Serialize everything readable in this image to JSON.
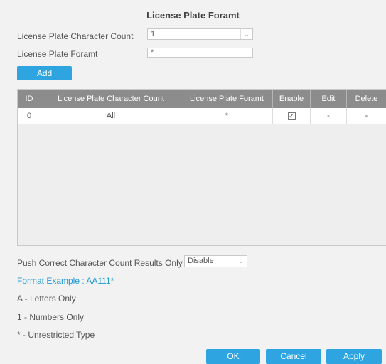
{
  "dialog": {
    "title": "License Plate Foramt"
  },
  "form": {
    "count_label": "License Plate Character Count",
    "count_value": "1",
    "format_label": "License Plate Foramt",
    "format_value": "*",
    "add_button": "Add"
  },
  "table": {
    "headers": [
      "ID",
      "License Plate Character Count",
      "License Plate Foramt",
      "Enable",
      "Edit",
      "Delete"
    ],
    "rows": [
      {
        "id": "0",
        "count": "All",
        "format": "*",
        "enable": true,
        "edit": "-",
        "delete": "-"
      }
    ]
  },
  "push": {
    "label": "Push Correct Character Count Results Only",
    "value": "Disable"
  },
  "help": {
    "example": "Format Example : AA111*",
    "letters": "A - Letters Only",
    "numbers": "1 - Numbers Only",
    "unrestricted": "* - Unrestricted Type"
  },
  "footer": {
    "ok": "OK",
    "cancel": "Cancel",
    "apply": "Apply"
  },
  "colors": {
    "accent": "#2ea5e0",
    "link": "#1e9ad6",
    "header_bg": "#8c8c8c"
  },
  "icons": {
    "dropdown": "chevron-down-icon",
    "checkbox": "checkbox-checked-icon"
  }
}
